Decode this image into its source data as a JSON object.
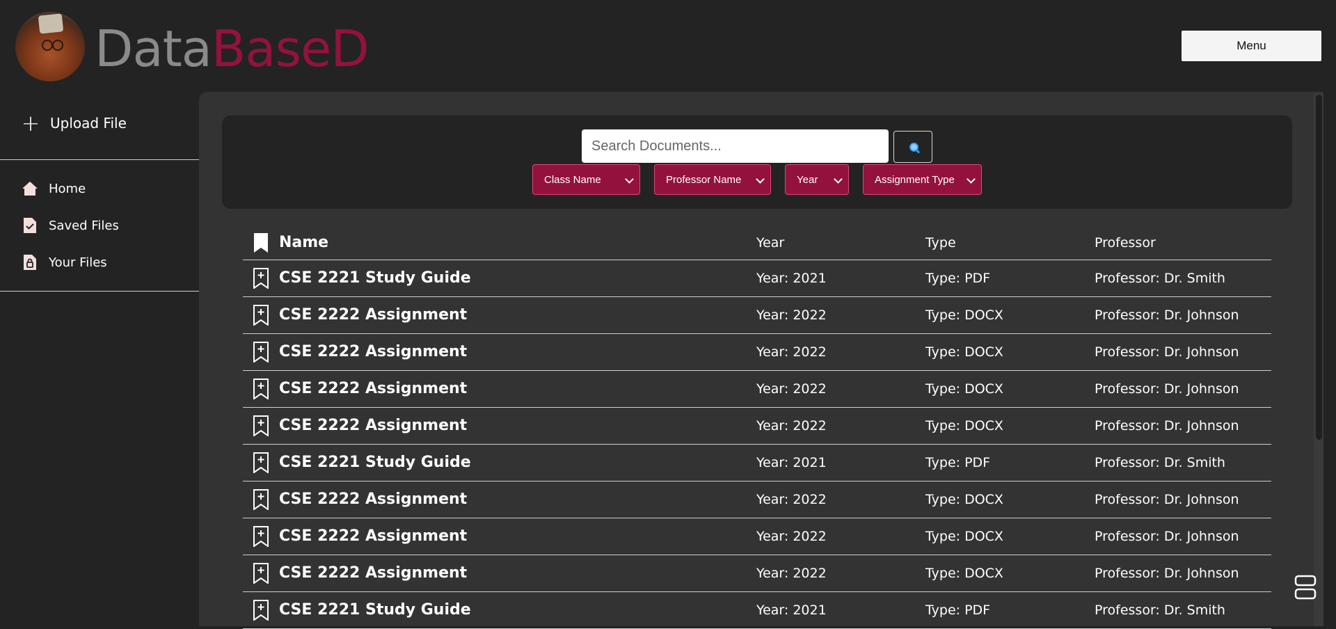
{
  "header": {
    "logo_text_part1": "Data",
    "logo_text_part2": "BaseD",
    "menu_label": "Menu"
  },
  "sidebar": {
    "upload_label": "Upload File",
    "items": [
      {
        "label": "Home",
        "icon": "home-icon"
      },
      {
        "label": "Saved Files",
        "icon": "saved-file-icon"
      },
      {
        "label": "Your Files",
        "icon": "locked-file-icon"
      }
    ]
  },
  "search": {
    "placeholder": "Search Documents...",
    "button_icon": "magnifier-icon"
  },
  "filters": [
    "Class Name",
    "Professor Name",
    "Year",
    "Assignment Type"
  ],
  "table": {
    "columns": [
      "Name",
      "Year",
      "Type",
      "Professor"
    ],
    "rows": [
      {
        "name": "CSE 2221 Study Guide",
        "year": "Year: 2021",
        "type": "Type: PDF",
        "professor": "Professor: Dr. Smith"
      },
      {
        "name": "CSE 2222 Assignment",
        "year": "Year: 2022",
        "type": "Type: DOCX",
        "professor": "Professor: Dr. Johnson"
      },
      {
        "name": "CSE 2222 Assignment",
        "year": "Year: 2022",
        "type": "Type: DOCX",
        "professor": "Professor: Dr. Johnson"
      },
      {
        "name": "CSE 2222 Assignment",
        "year": "Year: 2022",
        "type": "Type: DOCX",
        "professor": "Professor: Dr. Johnson"
      },
      {
        "name": "CSE 2222 Assignment",
        "year": "Year: 2022",
        "type": "Type: DOCX",
        "professor": "Professor: Dr. Johnson"
      },
      {
        "name": "CSE 2221 Study Guide",
        "year": "Year: 2021",
        "type": "Type: PDF",
        "professor": "Professor: Dr. Smith"
      },
      {
        "name": "CSE 2222 Assignment",
        "year": "Year: 2022",
        "type": "Type: DOCX",
        "professor": "Professor: Dr. Johnson"
      },
      {
        "name": "CSE 2222 Assignment",
        "year": "Year: 2022",
        "type": "Type: DOCX",
        "professor": "Professor: Dr. Johnson"
      },
      {
        "name": "CSE 2222 Assignment",
        "year": "Year: 2022",
        "type": "Type: DOCX",
        "professor": "Professor: Dr. Johnson"
      },
      {
        "name": "CSE 2221 Study Guide",
        "year": "Year: 2021",
        "type": "Type: PDF",
        "professor": "Professor: Dr. Smith"
      }
    ]
  },
  "colors": {
    "accent": "#93123d",
    "background": "#232323",
    "panel": "#333333"
  }
}
